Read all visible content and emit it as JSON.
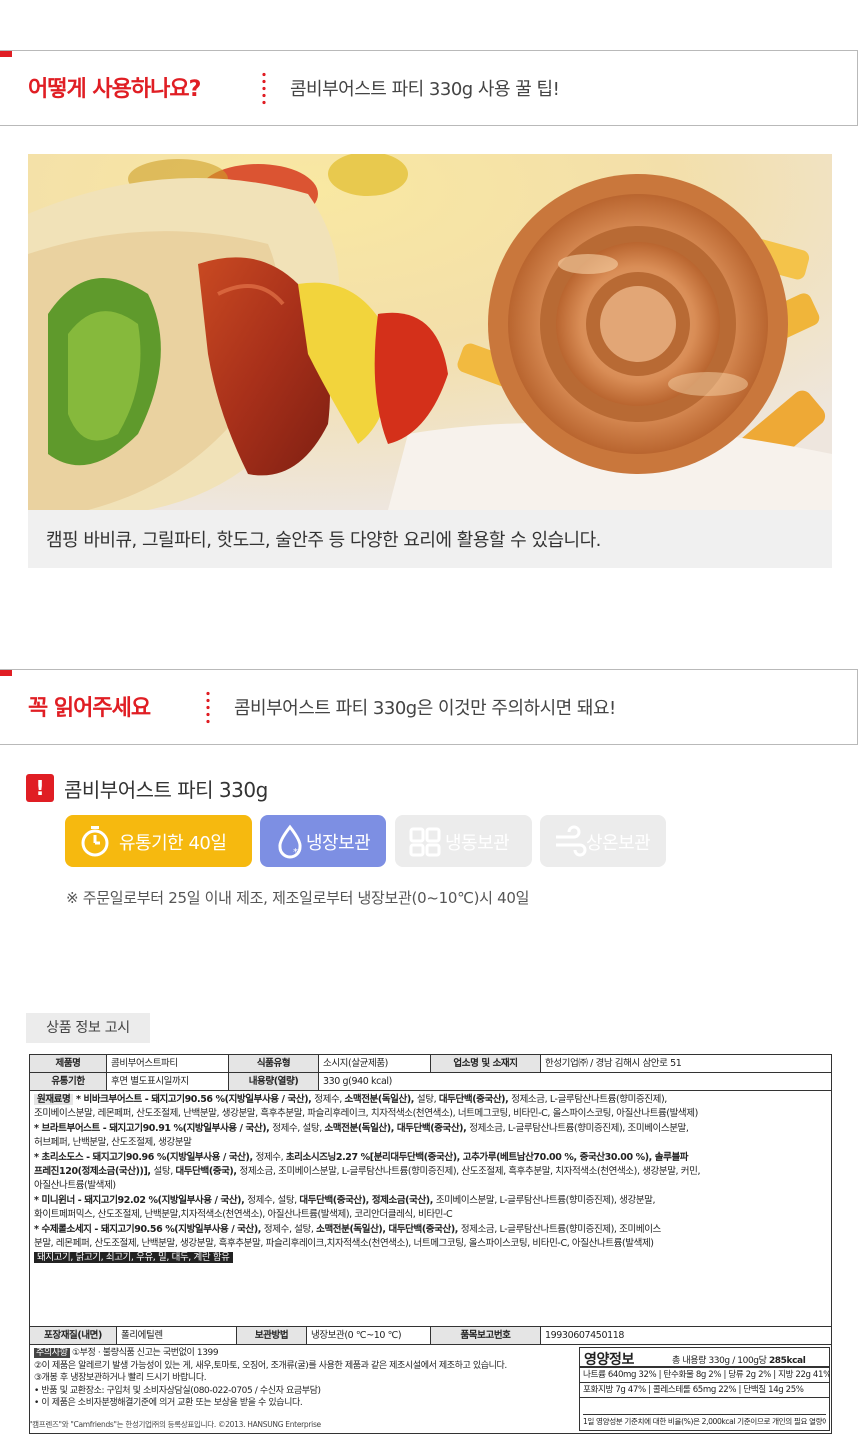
{
  "section1": {
    "title": "어떻게 사용하나요?",
    "subtitle": "콤비부어스트 파티 330g 사용 꿀 팁!",
    "photo_caption": "캠핑 바비큐, 그릴파티, 핫도그, 술안주 등 다양한 요리에 활용할 수 있습니다."
  },
  "section2": {
    "title": "꼭 읽어주세요",
    "subtitle": "콤비부어스트 파티 330g은 이것만 주의하시면 돼요!",
    "product_name": "콤비부어스트 파티 330g",
    "badges": {
      "shelf_life": "유통기한 40일",
      "refrigerated": "냉장보관",
      "frozen": "냉동보관",
      "room_temp": "상온보관"
    },
    "storage_note": "※ 주문일로부터 25일 이내 제조, 제조일로부터 냉장보관(0~10℃)시 40일"
  },
  "info_tab": "상품 정보 고시",
  "table": {
    "row1": {
      "product_label": "제품명",
      "product_value": "콤비부어스트파티",
      "type_label": "식품유형",
      "type_value": "소시지(살균제품)",
      "maker_label": "업소명 및 소재지",
      "maker_value": "한성기업㈜  /   경남 김해시 삼안로 51"
    },
    "row2": {
      "expiry_label": "유통기한",
      "expiry_value": "후면 별도표시일까지",
      "volume_label": "내용량(열량)",
      "volume_value": "330 g(940 kcal)"
    },
    "raw_label": "원재료명",
    "raw_lines": [
      [
        "* 비바크부어스트 - 돼지고기90.56 %(지방일부사용 / 국산), ",
        "정제수, ",
        "소맥전분(독일산), ",
        "설탕, ",
        "대두단백(중국산), ",
        "정제소금, L-글루탐산나트륨(향미증진제),"
      ],
      [
        "조미베이스분말, 레몬페퍼, 산도조절제, 난백분말, 생강분말, 흑후추분말, 파슬리후레이크, 치자적색소(천연색소), 너트메그코팅, 비타민-C, 올스파이스코팅, 아질산나트륨(발색제)"
      ],
      [
        "* 브라트부어스트 - 돼지고기90.91 %(지방일부사용 / 국산), ",
        "정제수, 설탕, ",
        "소맥전분(독일산), ",
        "대두단백(중국산), ",
        "정제소금, L-글루탐산나트륨(향미증진제), 조미베이스분말,"
      ],
      [
        "허브페퍼, 난백분말, 산도조절제, 생강분말"
      ],
      [
        "* 초리소도스 - 돼지고기90.96 %(지방일부사용 / 국산), ",
        "정제수, ",
        "초리소시즈닝2.27 %[분리대두단백(중국산), 고추가루(베트남산70.00 %, 중국산30.00 %), 솔루블파"
      ],
      [
        "프레진120(정제소금(국산))], ",
        "설탕, ",
        "대두단백(중국), ",
        "정제소금, 조미베이스분말, L-글루탐산나트륨(향미증진제), 산도조절제, 흑후추분말, 치자적색소(천연색소), 생강분말, 커민,"
      ],
      [
        "아질산나트륨(발색제)"
      ],
      [
        "* 미니윈너 - 돼지고기92.02 %(지방일부사용 / 국산), ",
        "정제수, 설탕, ",
        "대두단백(중국산), ",
        "정제소금(국산), ",
        "조미베이스분말, L-글루탐산나트륨(향미증진제), 생강분말,"
      ],
      [
        "화이트페퍼믹스, 산도조절제, 난백분말,치자적색소(천연색소), 아질산나트륨(발색제), 코리안더클레식, 비타민-C"
      ],
      [
        "* 수제롤소세지 - 돼지고기90.56 %(지방일부사용 / 국산), ",
        "정제수, 설탕, ",
        "소맥전분(독일산), ",
        "대두단백(중국산), ",
        "정제소금, L-글루탐산나트륨(향미증진제), 조미베이스"
      ],
      [
        "분말, 레몬페퍼, 산도조절제, 난백분말, 생강분말, 흑후추분말, 파슬리후레이크,치자적색소(천연색소), 너트메그코팅, 올스파이스코팅, 비타민-C, 아질산나트륨(발색제)"
      ]
    ],
    "allergen": "돼지고기, 닭고기, 쇠고기, 우유, 밀, 대두, 계란 함유",
    "row3": {
      "pack_label": "포장재질(내면)",
      "pack_value": "폴리에틸렌",
      "storage_label": "보관방법",
      "storage_value": "냉장보관(0 ℃~10 ℃)",
      "report_label": "품목보고번호",
      "report_value": "19930607450118"
    },
    "notes": {
      "tag": "주의사항",
      "lines": [
        "①부정 · 불량식품 신고는 국번없이 1399",
        "②이 제품은 알레르기 발생 가능성이 있는 게, 새우,토마토, 오징어, 조개류(굴)를 사용한 제품과 같은 제조시설에서 제조하고 있습니다.",
        "③개봉 후 냉장보관하거나 빨리 드시기 바랍니다.",
        " • 반품 및 교환장소: 구입처 및 소비자상담실(080-022-0705 / 수신자 요금부담)",
        " • 이 제품은 소비자분쟁해결기준에 의거 교환 또는 보상을 받을 수 있습니다."
      ]
    },
    "nutrition": {
      "title": "영양정보",
      "total": "총 내용량 330g / 100g당",
      "kcal": "285kcal",
      "row1": "나트륨 640mg 32% | 탄수화물 8g 2% | 당류 2g 2% | 지방 22g 41% | 트랜스지방 0g",
      "row2": "포화지방 7g 47% | 콜레스테롤 65mg 22% | 단백질 14g 25%",
      "foot": "1일 영양성분 기준치에 대한 비율(%)은 2,000kcal 기준이므로 개인의 필요 열량에 따라 다를 수 있습니다."
    }
  },
  "copyright": "\"캠프렌즈\"와 \"Camfriends\"는 한성기업㈜의 등록상표입니다.  ©2013. HANSUNG Enterprise",
  "colors": {
    "accent": "#e01e24",
    "shelf_badge": "#f6b90f",
    "fridge_badge": "#7d8fe3",
    "inactive_badge": "#ececec"
  }
}
